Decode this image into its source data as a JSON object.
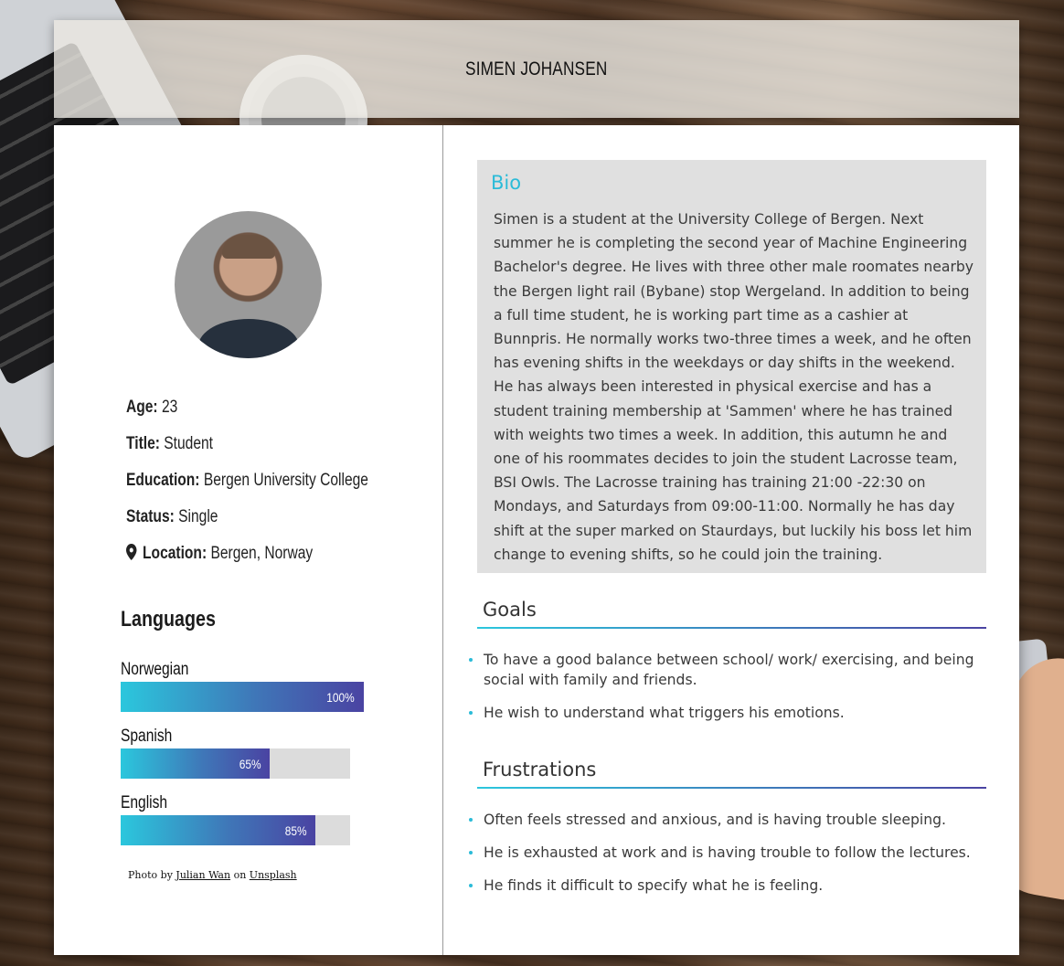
{
  "header": {
    "name": "SIMEN JOHANSEN"
  },
  "profile": {
    "age_label": "Age:",
    "age": "23",
    "title_label": "Title:",
    "title": "Student",
    "education_label": "Education:",
    "education": "Bergen University College",
    "status_label": "Status:",
    "status": "Single",
    "location_label": "Location:",
    "location": "Bergen, Norway"
  },
  "languages": {
    "heading": "Languages",
    "items": [
      {
        "name": "Norwegian",
        "level": 100,
        "level_label": "100%"
      },
      {
        "name": "Spanish",
        "level": 65,
        "level_label": "65%"
      },
      {
        "name": "English",
        "level": 85,
        "level_label": "85%"
      }
    ]
  },
  "credit": {
    "prefix": "Photo by",
    "author": "Julian Wan",
    "middle": "on",
    "site": "Unsplash"
  },
  "bio": {
    "heading": "Bio",
    "text": "Simen is a student at the University College of Bergen. Next summer he is completing the second year of Machine Engineering Bachelor's degree. He lives with three other male roomates nearby the Bergen light rail (Bybane) stop Wergeland. In addition to being a full time student, he is working part time as a cashier at Bunnpris. He normally works two-three times a week, and he often has evening shifts in the weekdays or day shifts in the weekend. He has always been interested in physical exercise and has a student training membership at 'Sammen' where he has trained with weights two times a week. In addition, this autumn he and one of his roommates decides to join the student Lacrosse team, BSI Owls. The Lacrosse training has training 21:00 -22:30 on Mondays, and Saturdays from 09:00-11:00. Normally he has day shift at the super marked on Staurdays, but luckily his boss let him change to evening shifts, so he could join the training."
  },
  "goals": {
    "heading": "Goals",
    "items": [
      "To have a good balance between school/ work/ exercising, and being social with family and friends.",
      "He wish to understand what triggers his emotions."
    ]
  },
  "frustrations": {
    "heading": "Frustrations",
    "items": [
      "Often feels stressed and anxious, and is having trouble sleeping.",
      "He is exhausted at work and is having trouble to follow the lectures.",
      "He finds it difficult to specify what he is feeling."
    ]
  },
  "colors": {
    "accent": "#2bbbd8",
    "bar_start": "#2bc7dd",
    "bar_end": "#4a43a2",
    "bio_bg": "#e0e0e0"
  },
  "icons": {
    "location": "map-pin-icon"
  }
}
